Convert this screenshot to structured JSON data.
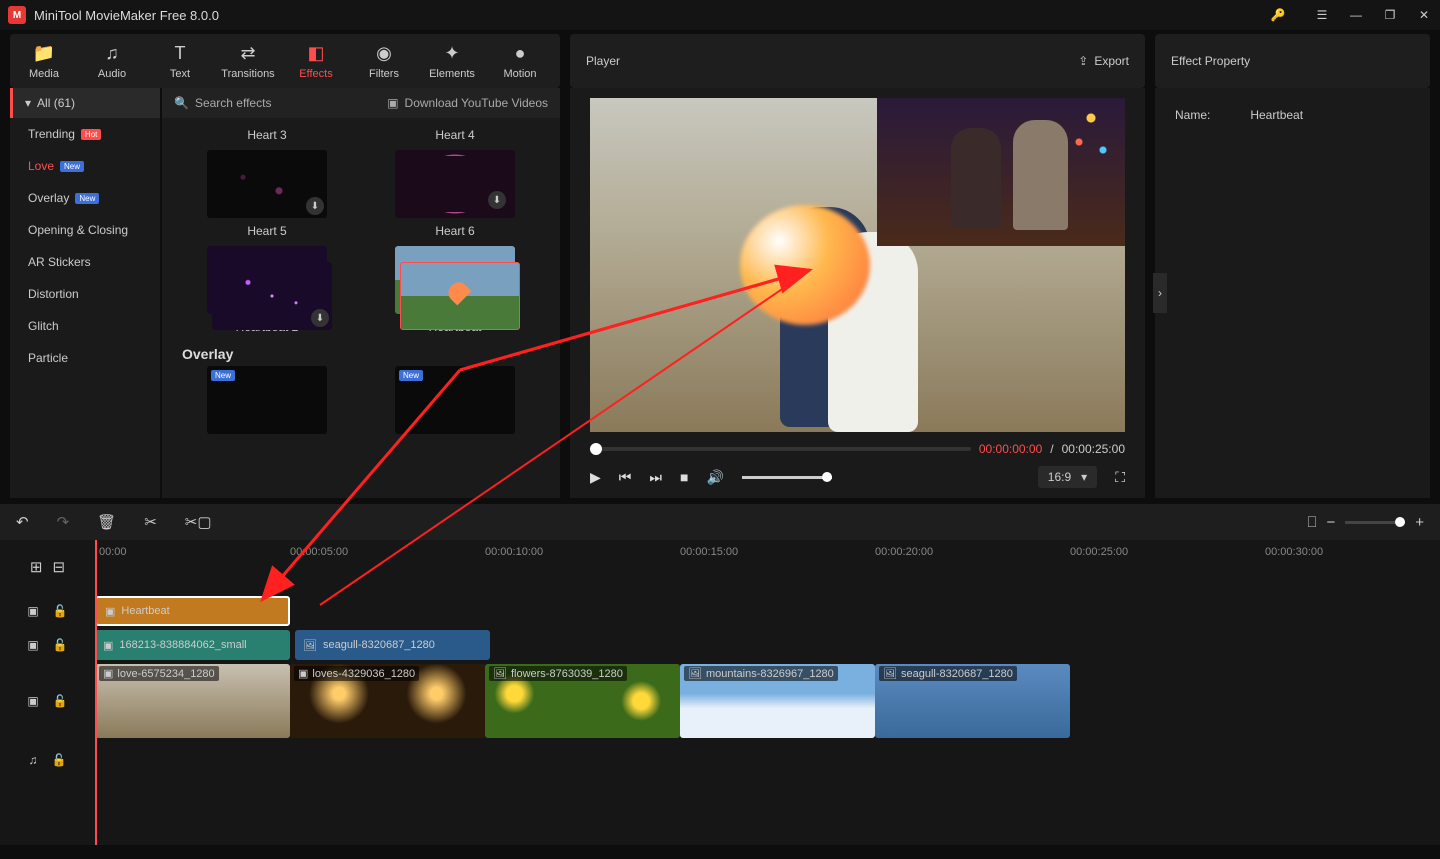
{
  "app": {
    "title": "MiniTool MovieMaker Free 8.0.0"
  },
  "tabs": {
    "media": "Media",
    "audio": "Audio",
    "text": "Text",
    "transitions": "Transitions",
    "effects": "Effects",
    "filters": "Filters",
    "elements": "Elements",
    "motion": "Motion"
  },
  "player_label": "Player",
  "export_label": "Export",
  "prop_header": "Effect Property",
  "categories": {
    "all": "All (61)",
    "trending": "Trending",
    "love": "Love",
    "overlay": "Overlay",
    "opening": "Opening & Closing",
    "ar": "AR Stickers",
    "distortion": "Distortion",
    "glitch": "Glitch",
    "particle": "Particle",
    "hot_badge": "Hot",
    "new_badge": "New"
  },
  "search_placeholder": "Search effects",
  "download_yt": "Download YouTube Videos",
  "effects": {
    "heart3": "Heart 3",
    "heart4": "Heart 4",
    "heart5": "Heart 5",
    "heart6": "Heart 6",
    "heartbeat2": "Heartbeat 2",
    "heartbeat": "Heartbeat",
    "overlay_section": "Overlay"
  },
  "player": {
    "time_current": "00:00:00:00",
    "time_sep": " / ",
    "time_duration": "00:00:25:00",
    "aspect": "16:9"
  },
  "property": {
    "name_label": "Name:",
    "name_value": "Heartbeat"
  },
  "ruler": [
    "00:00",
    "00:00:05:00",
    "00:00:10:00",
    "00:00:15:00",
    "00:00:20:00",
    "00:00:25:00",
    "00:00:30:00"
  ],
  "clips": {
    "effect": "Heartbeat",
    "overlay1": "168213-838884062_small",
    "overlay2": "seagull-8320687_1280",
    "v1": "love-6575234_1280",
    "v2": "loves-4329036_1280",
    "v3": "flowers-8763039_1280",
    "v4": "mountains-8326967_1280",
    "v5": "seagull-8320687_1280"
  }
}
